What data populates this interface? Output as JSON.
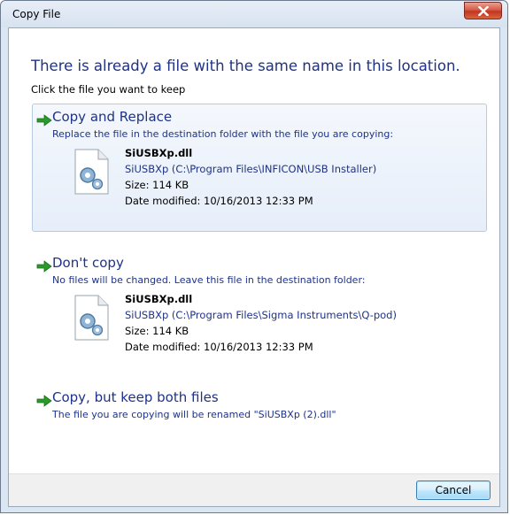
{
  "window": {
    "title": "Copy File",
    "close_glyph": "X"
  },
  "dialog": {
    "heading": "There is already a file with the same name in this location.",
    "subheading": "Click the file you want to keep"
  },
  "options": [
    {
      "title": "Copy and Replace",
      "description": "Replace the file in the destination folder with the file you are copying:",
      "file": {
        "name": "SiUSBXp.dll",
        "path": "SiUSBXp (C:\\Program Files\\INFICON\\USB Installer)",
        "size": "Size: 114 KB",
        "date": "Date modified: 10/16/2013 12:33 PM"
      }
    },
    {
      "title": "Don't copy",
      "description": "No files will be changed. Leave this file in the destination folder:",
      "file": {
        "name": "SiUSBXp.dll",
        "path": "SiUSBXp (C:\\Program Files\\Sigma Instruments\\Q-pod)",
        "size": "Size: 114 KB",
        "date": "Date modified: 10/16/2013 12:33 PM"
      }
    },
    {
      "title": "Copy, but keep both files",
      "description": "The file you are copying will be renamed \"SiUSBXp (2).dll\""
    }
  ],
  "footer": {
    "cancel_label": "Cancel"
  },
  "icons": {
    "arrow": "green-arrow-icon",
    "file": "dll-file-icon",
    "close": "close-icon"
  },
  "colors": {
    "link_blue": "#1e3287",
    "arrow_green": "#2a9a2a",
    "close_red": "#c2351f",
    "highlight_border": "#b6cbe6"
  }
}
